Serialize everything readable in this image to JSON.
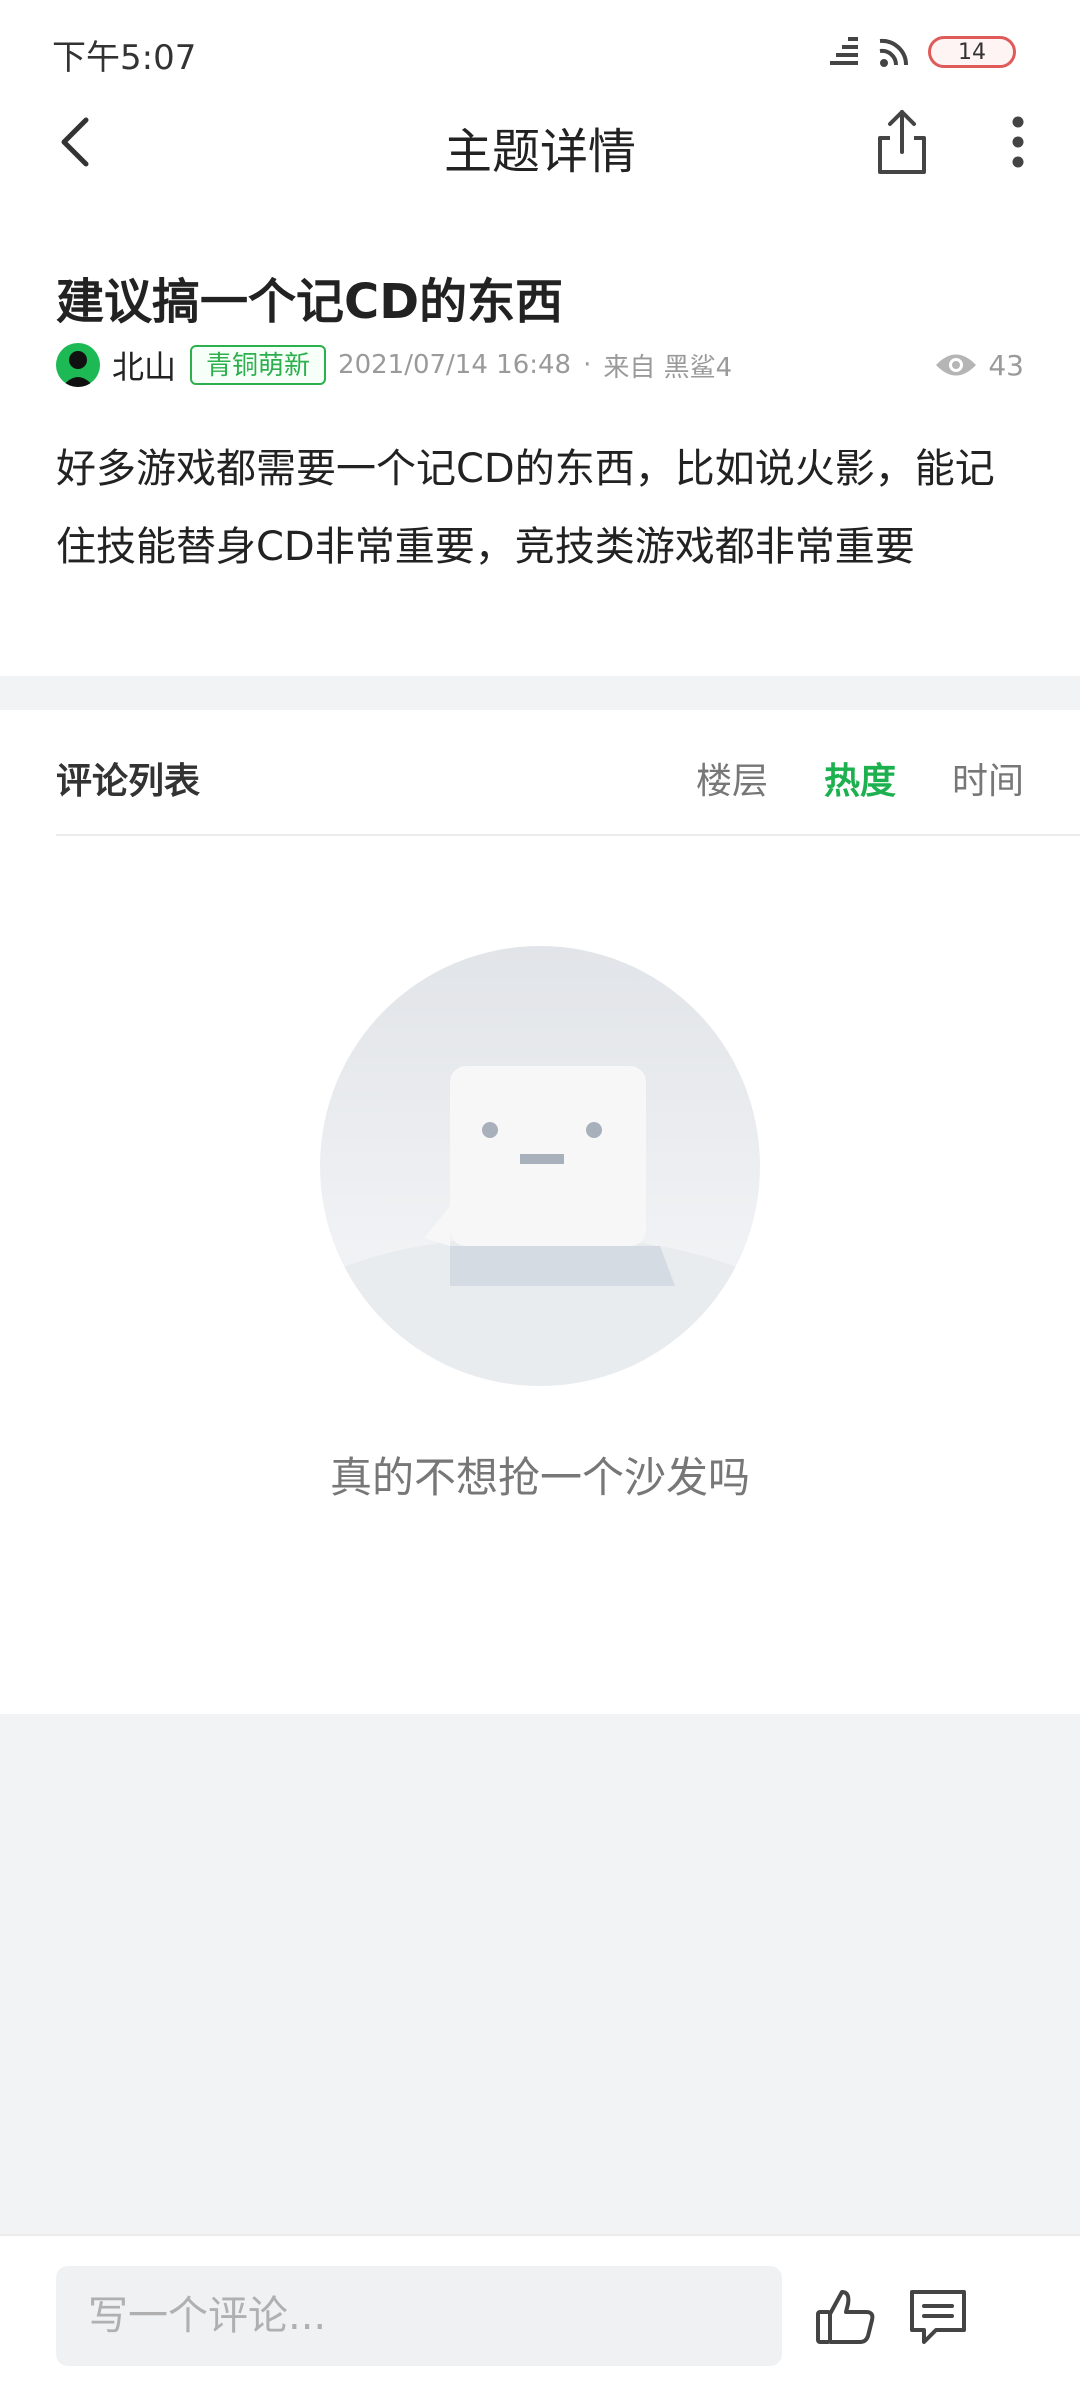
{
  "status_bar": {
    "time": "下午5:07",
    "battery": "14",
    "icons": [
      "signal-icon",
      "wifi-icon",
      "battery-icon"
    ]
  },
  "header": {
    "title": "主题详情",
    "icons": [
      "back-arrow-icon",
      "share-icon",
      "more-vertical-icon"
    ]
  },
  "post": {
    "title": "建议搞一个记CD的东西",
    "author": "北山",
    "badge": "青铜萌新",
    "date": "2021/07/14 16:48",
    "separator": "·",
    "source": "来自 黑鲨4",
    "views": "43",
    "body": "好多游戏都需要一个记CD的东西，比如说火影，能记住技能替身CD非常重要，竞技类游戏都非常重要"
  },
  "comments": {
    "title": "评论列表",
    "sort_tabs": [
      {
        "label": "楼层",
        "active": false
      },
      {
        "label": "热度",
        "active": true
      },
      {
        "label": "时间",
        "active": false
      }
    ],
    "empty_text": "真的不想抢一个沙发吗"
  },
  "bottom_bar": {
    "placeholder": "写一个评论...",
    "icons": [
      "thumbs-up-icon",
      "comment-icon"
    ]
  },
  "colors": {
    "accent": "#1cb14e",
    "badge_border": "#2cb04e",
    "background": "#f2f3f5"
  }
}
